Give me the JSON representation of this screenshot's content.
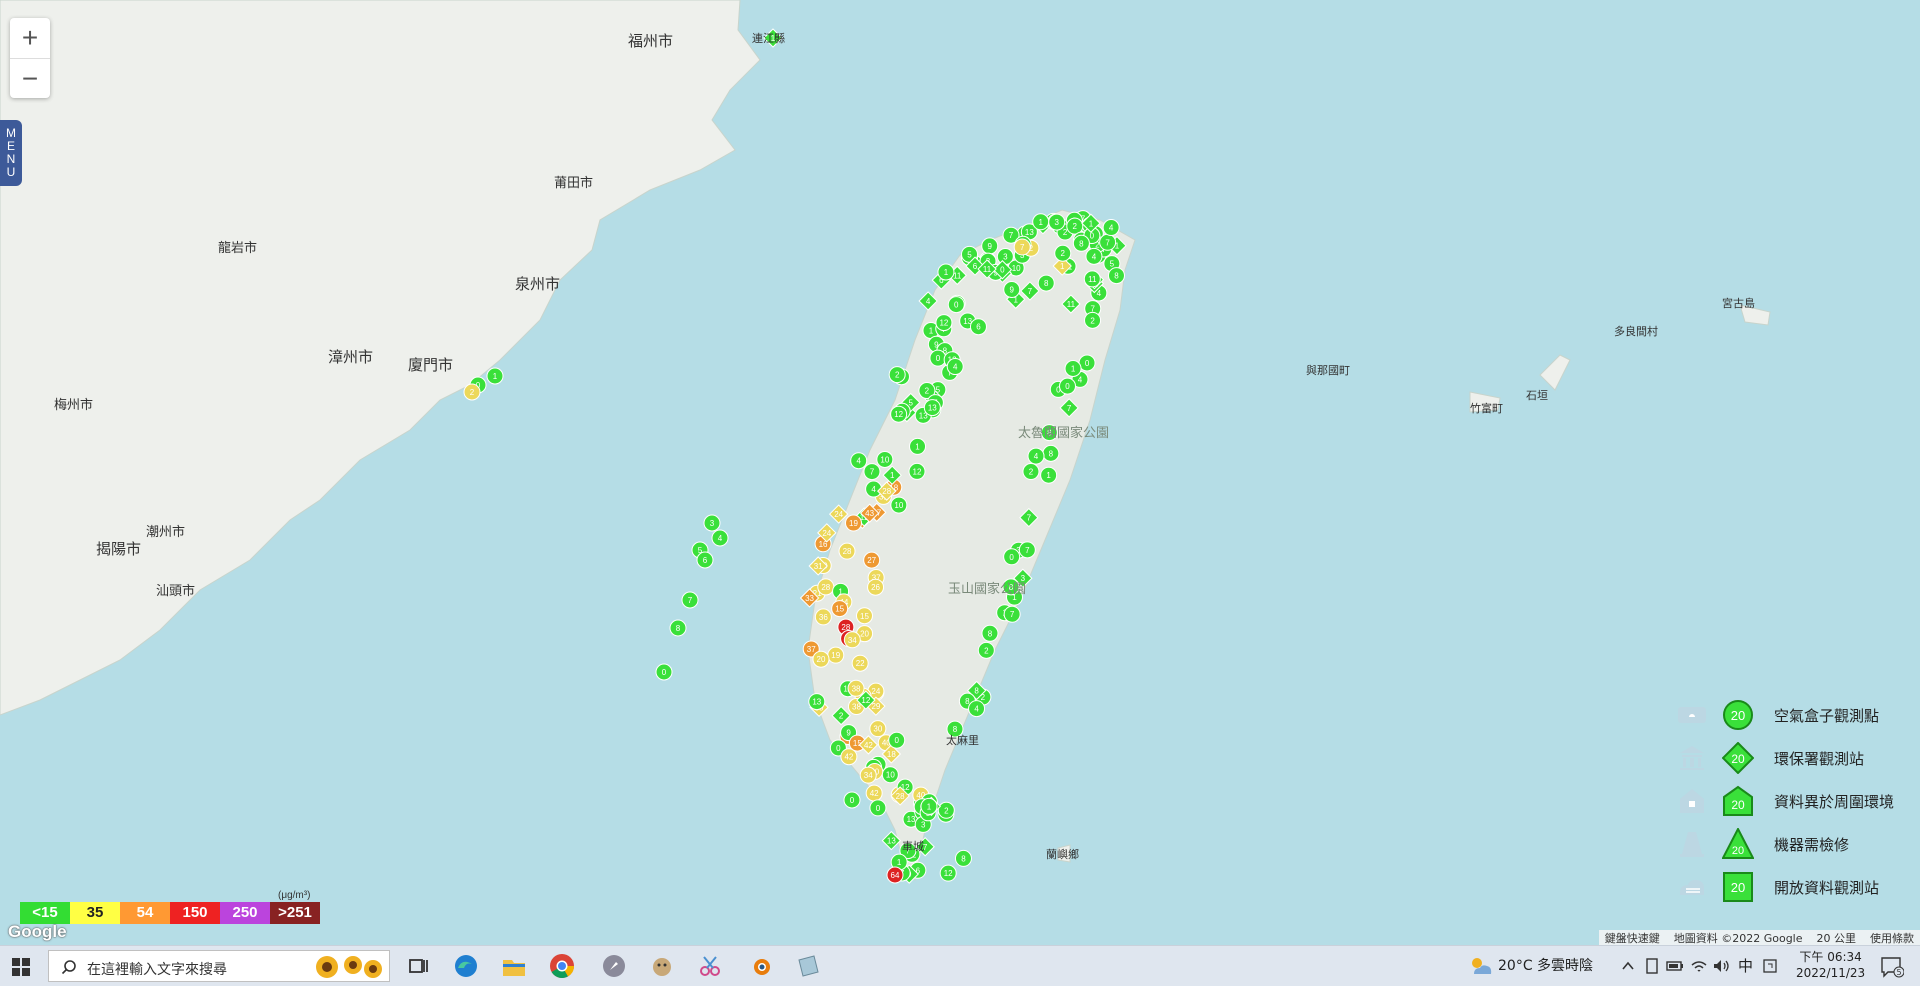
{
  "map": {
    "cities": [
      {
        "id": "fuzhou",
        "label": "福州市"
      },
      {
        "id": "lianjiang",
        "label": "連江縣"
      },
      {
        "id": "putian",
        "label": "莆田市"
      },
      {
        "id": "longyan",
        "label": "龍岩市"
      },
      {
        "id": "quanzhou",
        "label": "泉州市"
      },
      {
        "id": "zhangzhou",
        "label": "漳州市"
      },
      {
        "id": "xiamen",
        "label": "廈門市"
      },
      {
        "id": "meizhou",
        "label": "梅州市"
      },
      {
        "id": "chaozhou",
        "label": "潮州市"
      },
      {
        "id": "jieyang",
        "label": "揭陽市"
      },
      {
        "id": "shantou",
        "label": "汕頭市"
      },
      {
        "id": "yonaguni",
        "label": "與那國町"
      },
      {
        "id": "taketomi",
        "label": "竹富町"
      },
      {
        "id": "ishigaki",
        "label": "石垣"
      },
      {
        "id": "tarama",
        "label": "多良間村"
      },
      {
        "id": "miyakojima",
        "label": "宮古島"
      },
      {
        "id": "taimali",
        "label": "太麻里"
      },
      {
        "id": "lanyu",
        "label": "蘭嶼鄉"
      },
      {
        "id": "hengchun",
        "label": "車城"
      }
    ],
    "features": [
      {
        "id": "taroko",
        "label": "太魯閣國家公園"
      },
      {
        "id": "yushan",
        "label": "玉山國家公園"
      }
    ],
    "colors": {
      "sea": "#b5dde6",
      "land": "#eef0ec",
      "taiwan": "#e6eae4"
    }
  },
  "zoom": {
    "in": "+",
    "out": "−"
  },
  "menu": {
    "label": "MENU"
  },
  "legend": {
    "items": [
      {
        "label": "空氣盒子觀測點",
        "value": "20",
        "shape": "circle",
        "icon": "airbox-icon"
      },
      {
        "label": "環保署觀測站",
        "value": "20",
        "shape": "diamond",
        "icon": "government-building-icon"
      },
      {
        "label": "資料異於周圍環境",
        "value": "20",
        "shape": "house",
        "icon": "house-icon"
      },
      {
        "label": "機器需檢修",
        "value": "20",
        "shape": "triangle",
        "icon": "traffic-cone-icon"
      },
      {
        "label": "開放資料觀測站",
        "value": "20",
        "shape": "square",
        "icon": "cloud-data-icon"
      }
    ]
  },
  "scale": {
    "unit": "(μg/m³)",
    "levels": [
      {
        "label": "<15",
        "color": "#33dd33"
      },
      {
        "label": "35",
        "color": "#ffff44"
      },
      {
        "label": "54",
        "color": "#ff9933"
      },
      {
        "label": "150",
        "color": "#ee2222"
      },
      {
        "label": "250",
        "color": "#bb44dd"
      },
      {
        "label": ">251",
        "color": "#882222"
      }
    ]
  },
  "attribution": {
    "google": "Google",
    "shortcuts": "鍵盤快速鍵",
    "mapdata": "地圖資料 ©2022 Google",
    "scale_label": "20 公里",
    "terms": "使用條款"
  },
  "sensor_colors": {
    "green": "#3ae03a",
    "yellow": "#ecd85a",
    "orange": "#ee9933",
    "red": "#dd2222"
  },
  "taskbar": {
    "search_placeholder": "在這裡輸入文字來搜尋",
    "weather": "20°C  多雲時陰",
    "ime": "中",
    "time": "下午 06:34",
    "date": "2022/11/23",
    "notif_count": "5"
  }
}
